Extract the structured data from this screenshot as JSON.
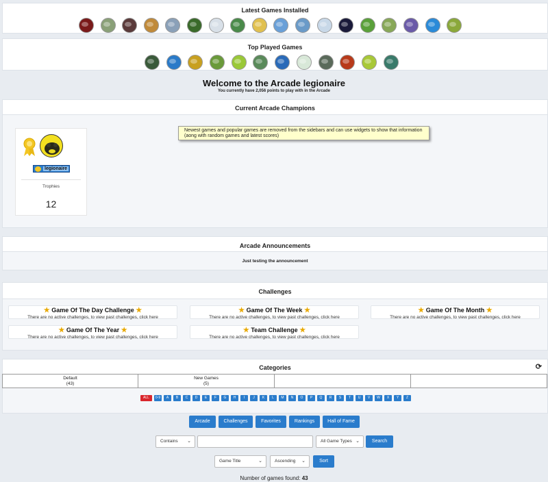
{
  "latest": {
    "title": "Latest Games Installed",
    "games": [
      {
        "name": "game-1",
        "color": "#7a1a1a"
      },
      {
        "name": "game-2",
        "color": "#8aa078"
      },
      {
        "name": "game-3",
        "color": "#5a3a3a"
      },
      {
        "name": "game-4",
        "color": "#c08a3a"
      },
      {
        "name": "game-5",
        "color": "#8aa0b8"
      },
      {
        "name": "game-6",
        "color": "#3a6a2a"
      },
      {
        "name": "game-7",
        "color": "#d8e0e8"
      },
      {
        "name": "game-8",
        "color": "#4a8a4a"
      },
      {
        "name": "game-9",
        "color": "#e0c050"
      },
      {
        "name": "game-10",
        "color": "#6aa0d8"
      },
      {
        "name": "game-11",
        "color": "#6a9ac8"
      },
      {
        "name": "game-12",
        "color": "#c8d8e8"
      },
      {
        "name": "game-13",
        "color": "#1a1a3a"
      },
      {
        "name": "game-14",
        "color": "#5aa03a"
      },
      {
        "name": "game-15",
        "color": "#88a858"
      },
      {
        "name": "game-16",
        "color": "#6a5aa8"
      },
      {
        "name": "game-17",
        "color": "#2a8ad8"
      },
      {
        "name": "game-18",
        "color": "#8aa83a"
      }
    ]
  },
  "top": {
    "title": "Top Played Games",
    "games": [
      {
        "name": "top-1",
        "color": "#3a5a3a"
      },
      {
        "name": "top-2",
        "color": "#2a7ac8"
      },
      {
        "name": "top-3",
        "color": "#c8a020"
      },
      {
        "name": "top-4",
        "color": "#6a9a3a"
      },
      {
        "name": "top-5",
        "color": "#9ac838"
      },
      {
        "name": "top-6",
        "color": "#5a8a5a"
      },
      {
        "name": "top-7",
        "color": "#2a6ab8"
      },
      {
        "name": "top-8",
        "color": "#d8e8d8"
      },
      {
        "name": "top-9",
        "color": "#5a6a5a"
      },
      {
        "name": "top-10",
        "color": "#b83a1a"
      },
      {
        "name": "top-11",
        "color": "#a8c838"
      },
      {
        "name": "top-12",
        "color": "#3a7a6a"
      }
    ]
  },
  "welcome": {
    "title": "Welcome to the Arcade legionaire",
    "subtitle": "You currently have 2,056 points to play with in the Arcade"
  },
  "champions": {
    "title": "Current Arcade Champions",
    "username": "legionaire",
    "trophies_label": "Trophies",
    "trophies_count": "12",
    "tooltip": "Newest games and popular games are removed from the sidebars and can use widgets to show that information (aong with random games and latest scores)"
  },
  "announcements": {
    "title": "Arcade Announcements",
    "text": "Just testing the announcement"
  },
  "challenges": {
    "title": "Challenges",
    "empty_text": "There are no active challenges, to view past challenges, click here",
    "items": [
      "Game Of The Day Challenge",
      "Game Of The Week",
      "Game Of The Month",
      "Game Of The Year",
      "Team Challenge"
    ]
  },
  "categories": {
    "title": "Categories",
    "cells": [
      {
        "name": "Default",
        "count": "(43)"
      },
      {
        "name": "New Games",
        "count": "(5)"
      },
      {
        "name": "",
        "count": ""
      },
      {
        "name": "",
        "count": ""
      }
    ],
    "letters": [
      "ALL",
      "0-9",
      "A",
      "B",
      "C",
      "D",
      "E",
      "F",
      "G",
      "H",
      "I",
      "J",
      "K",
      "L",
      "M",
      "N",
      "O",
      "P",
      "Q",
      "R",
      "S",
      "T",
      "U",
      "V",
      "W",
      "X",
      "Y",
      "Z"
    ]
  },
  "nav": [
    "Arcade",
    "Challenges",
    "Favorites",
    "Rankings",
    "Hall of Fame"
  ],
  "search": {
    "match_select": "Contains",
    "query": "",
    "type_select": "All Game Types",
    "button": "Search"
  },
  "sort": {
    "field_select": "Game Title",
    "order_select": "Ascending",
    "button": "Sort"
  },
  "footer": {
    "label": "Number of games found:",
    "count": "43"
  },
  "colors": {
    "accent": "#2a7ccc",
    "all_letter": "#d9262c",
    "tooltip_bg": "#ffffcc",
    "star": "#e8a800",
    "user_badge": "#2a7ccc"
  },
  "icons": {
    "refresh": "refresh-icon",
    "award": "award-ribbon-icon",
    "star": "star-icon"
  }
}
